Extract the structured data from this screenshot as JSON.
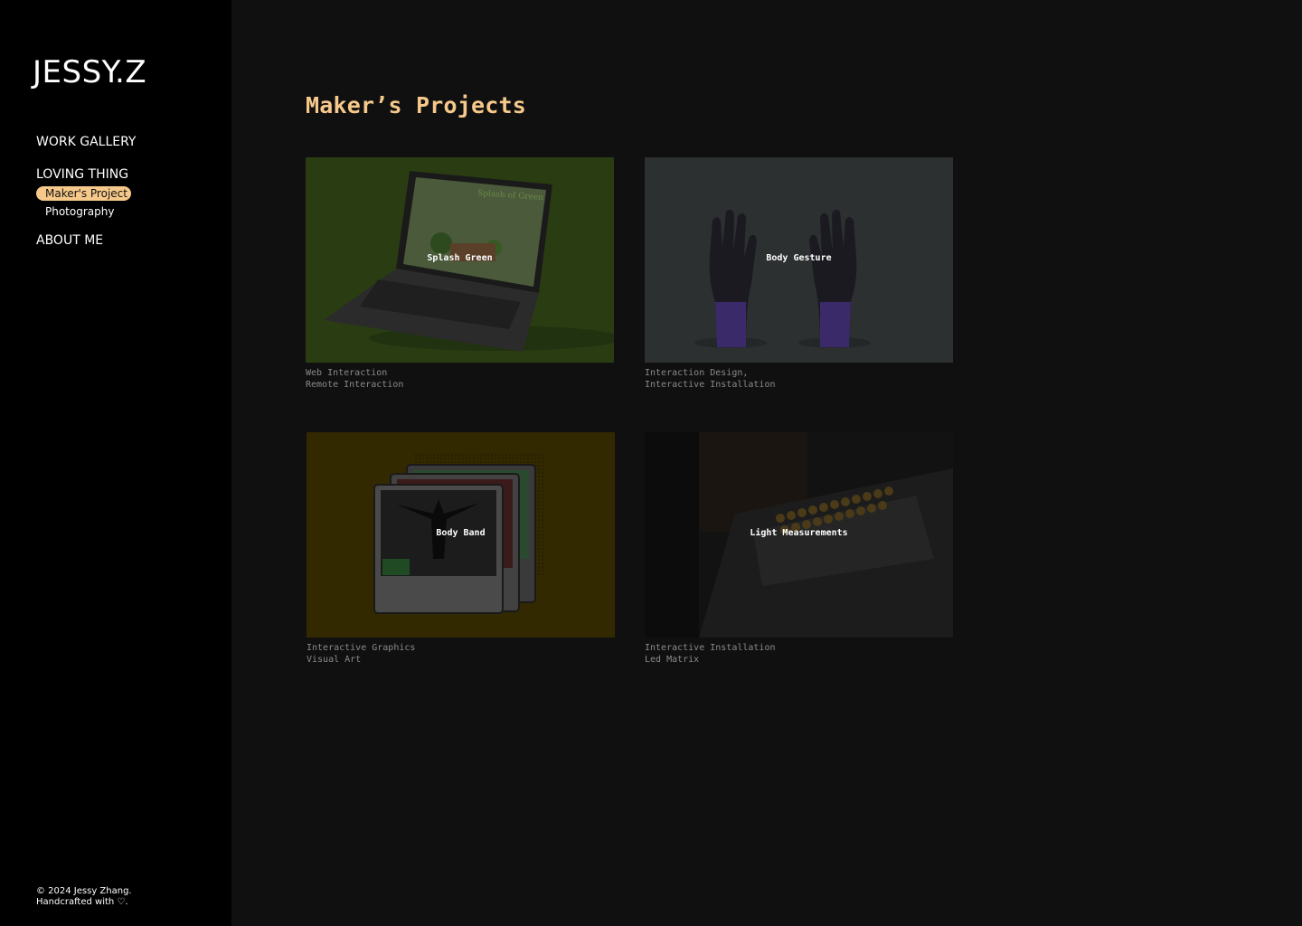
{
  "sidebar": {
    "logo": "JESSY.Z",
    "nav": {
      "work_gallery": "WORK GALLERY",
      "loving_thing": "LOVING THING",
      "sub_items": [
        "Maker's Project",
        "Photography"
      ],
      "about_me": "ABOUT ME"
    },
    "footer": {
      "line1": "© 2024 Jessy Zhang.",
      "line2": "Handcrafted with ♡."
    }
  },
  "main": {
    "title": "Maker’s Projects",
    "projects": [
      {
        "title": "Splash Green",
        "tags": [
          "Web Interaction",
          "Remote Interaction"
        ],
        "thumb_bg": "#2a3d12",
        "thumb_art": "laptop-mockup"
      },
      {
        "title": "Body Gesture",
        "tags": [
          "Interaction Design,",
          "Interactive Installation"
        ],
        "thumb_bg": "#2c3031",
        "thumb_art": "hands-sculpture"
      },
      {
        "title": "Body Band",
        "tags": [
          "Interactive Graphics",
          "Visual Art"
        ],
        "thumb_bg": "#332900",
        "thumb_art": "stacked-frames"
      },
      {
        "title": "Light Measurements",
        "tags": [
          "Interactive Installation",
          "Led Matrix"
        ],
        "thumb_bg": "#121212",
        "thumb_art": "led-matrix"
      }
    ]
  },
  "colors": {
    "accent": "#f6c98b",
    "sidebar_bg": "#000000",
    "main_bg": "#101010"
  }
}
